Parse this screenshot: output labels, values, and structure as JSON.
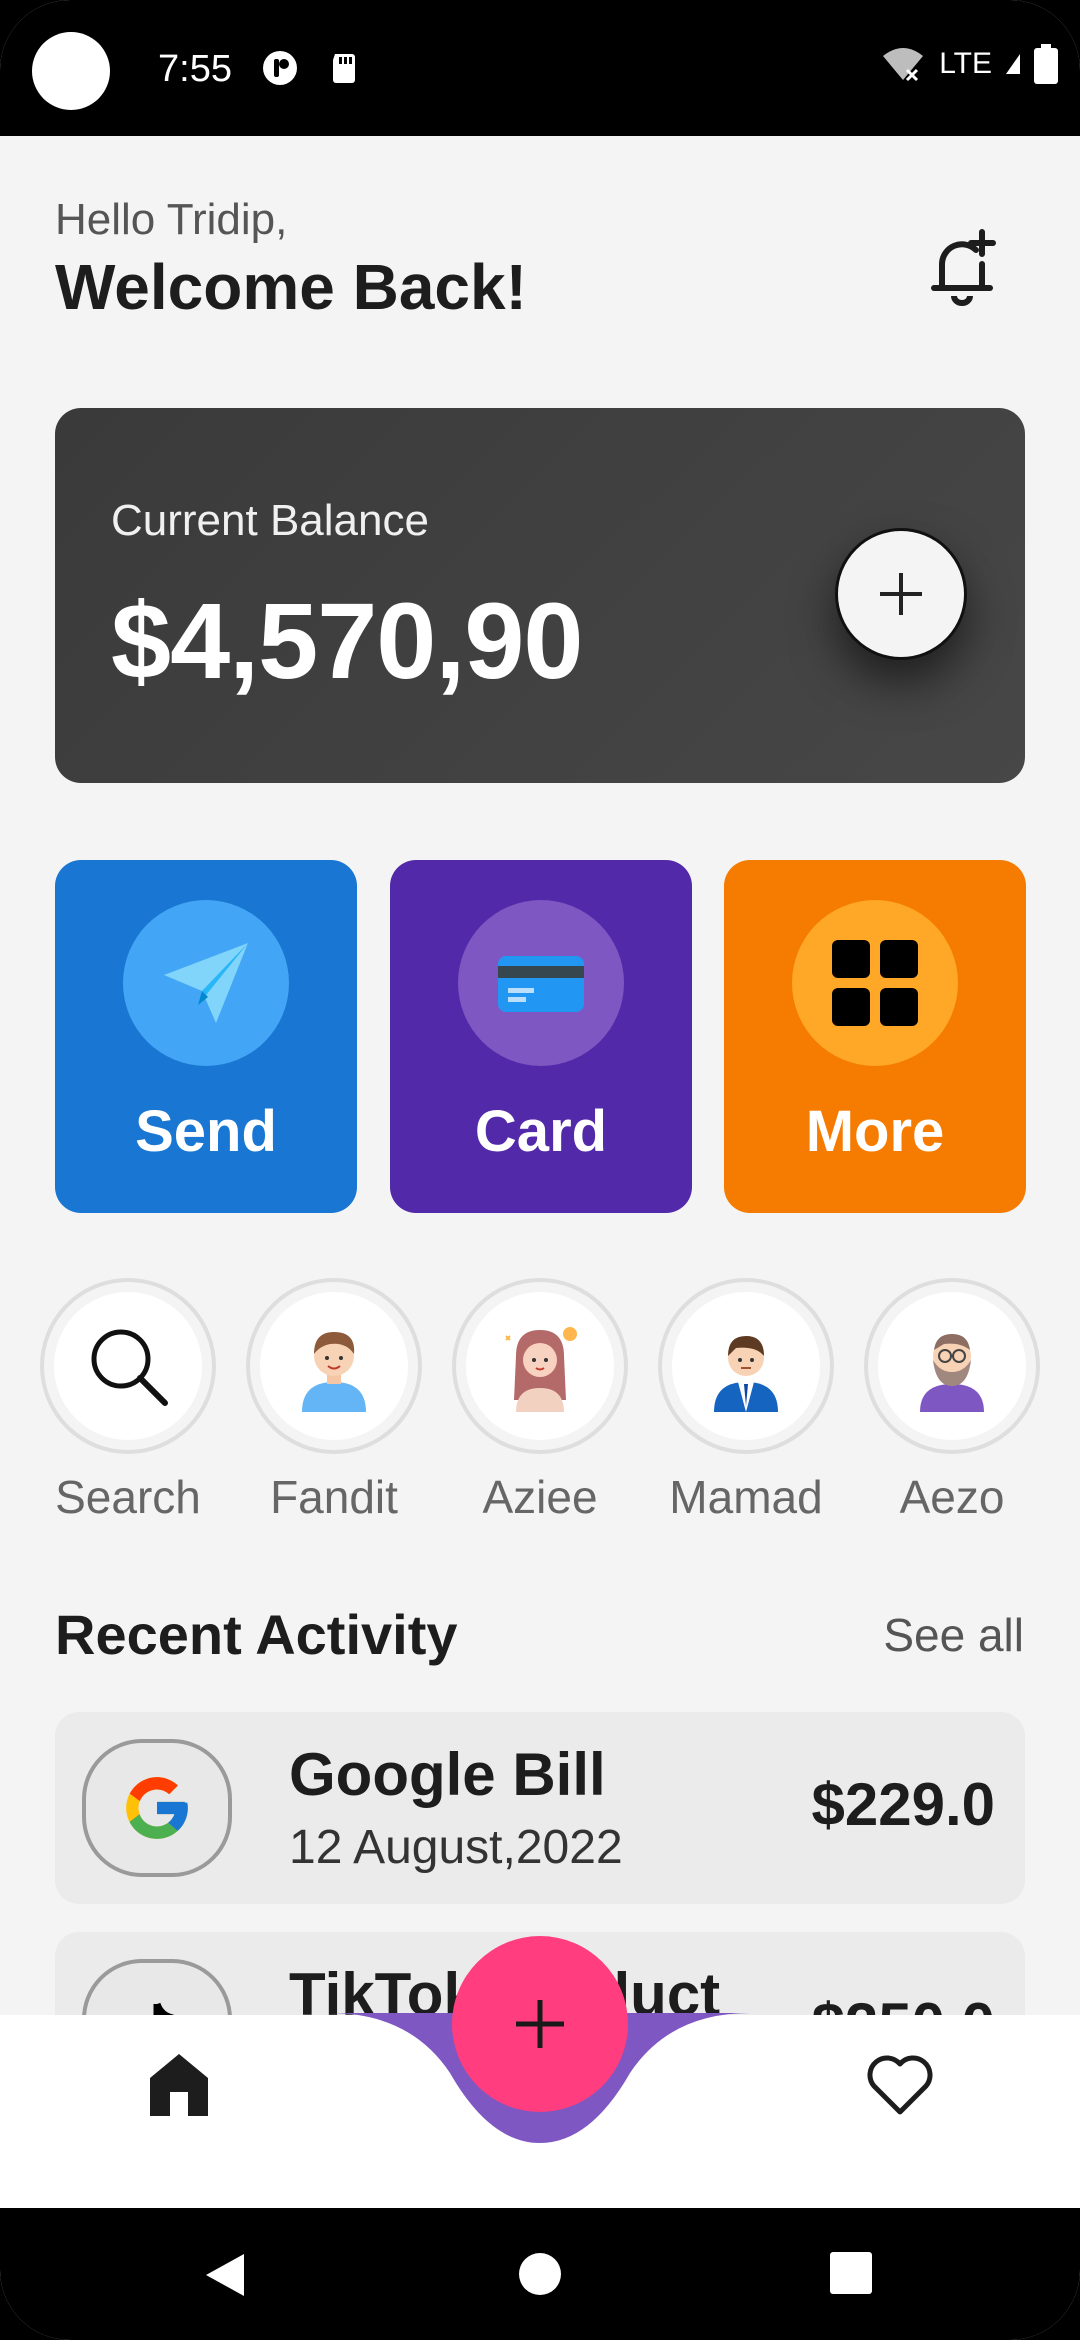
{
  "status_bar": {
    "time": "7:55",
    "network": "LTE"
  },
  "header": {
    "greeting": "Hello Tridip,",
    "title": "Welcome Back!"
  },
  "balance": {
    "label": "Current Balance",
    "amount": "$4,570,90"
  },
  "actions": [
    {
      "label": "Send",
      "color": "#1976d2"
    },
    {
      "label": "Card",
      "color": "#5229a8"
    },
    {
      "label": "More",
      "color": "#f57c00"
    }
  ],
  "contacts": [
    {
      "name": "Search"
    },
    {
      "name": "Fandit"
    },
    {
      "name": "Aziee"
    },
    {
      "name": "Mamad"
    },
    {
      "name": "Aezo"
    }
  ],
  "recent": {
    "title": "Recent Activity",
    "see_all": "See all",
    "items": [
      {
        "name": "Google Bill",
        "date": "12 August,2022",
        "amount": "$229.0",
        "icon": "google-logo-icon"
      },
      {
        "name": "TikTok Product",
        "date": "",
        "amount": "$250.0",
        "icon": "tiktok-logo-icon"
      }
    ]
  },
  "colors": {
    "fab": "#ff3d7f",
    "nav_curve": "#7e57c2",
    "card_bg": "#3f3f3f"
  }
}
